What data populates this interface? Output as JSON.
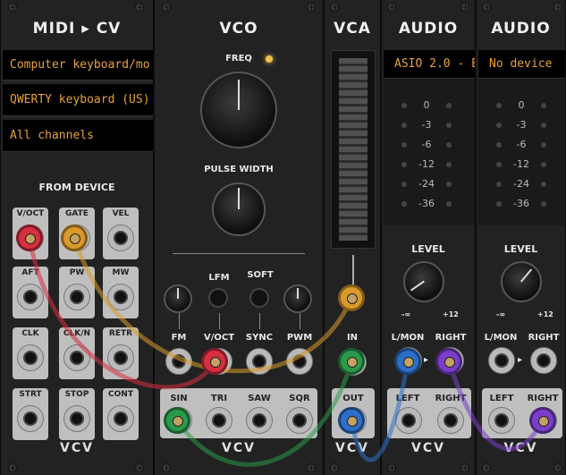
{
  "midi": {
    "title": "MIDI ▸ CV",
    "driver": "Computer keyboard/mo",
    "device": "QWERTY keyboard (US)",
    "channel": "All channels",
    "section": "FROM DEVICE",
    "ports": [
      "V/OCT",
      "GATE",
      "VEL",
      "AFT",
      "PW",
      "MW",
      "CLK",
      "CLK/N",
      "RETR",
      "STRT",
      "STOP",
      "CONT"
    ],
    "brand": "VCV"
  },
  "vco": {
    "title": "VCO",
    "freq": "FREQ",
    "pulse_width": "PULSE WIDTH",
    "lfm": "LFM",
    "soft": "SOFT",
    "inputs": [
      "FM",
      "V/OCT",
      "SYNC",
      "PWM"
    ],
    "outputs": [
      "SIN",
      "TRI",
      "SAW",
      "SQR"
    ],
    "brand": "VCV"
  },
  "vca": {
    "title": "VCA",
    "in": "IN",
    "out": "OUT",
    "brand": "VCV"
  },
  "audio1": {
    "title": "AUDIO",
    "device": "ASIO 2.0 - E",
    "levels": [
      "0",
      "-3",
      "-6",
      "-12",
      "-24",
      "-36"
    ],
    "level": "LEVEL",
    "min": "-∞",
    "max": "+12",
    "in_l": "L/MON",
    "in_r": "RIGHT",
    "out_l": "LEFT",
    "out_r": "RIGHT",
    "brand": "VCV"
  },
  "audio2": {
    "title": "AUDIO",
    "device": "No device",
    "levels": [
      "0",
      "-3",
      "-6",
      "-12",
      "-24",
      "-36"
    ],
    "level": "LEVEL",
    "min": "-∞",
    "max": "+12",
    "in_l": "L/MON",
    "in_r": "RIGHT",
    "out_l": "LEFT",
    "out_r": "RIGHT",
    "brand": "VCV"
  },
  "colors": {
    "display_text": "#e6a23c",
    "cable_red": "#d62f3f",
    "cable_yellow": "#d99a2b",
    "cable_green": "#2a9a4a",
    "cable_blue": "#2b6fc9",
    "cable_purple": "#7a3ec9"
  }
}
